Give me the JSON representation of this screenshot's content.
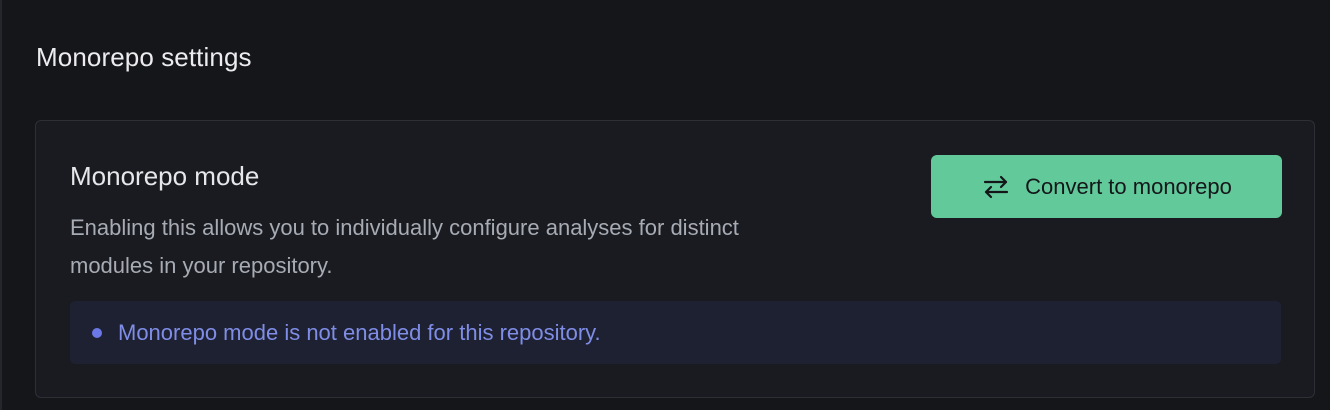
{
  "section": {
    "title": "Monorepo settings"
  },
  "card": {
    "title": "Monorepo mode",
    "description": "Enabling this allows you to individually configure analyses for distinct modules in your repository.",
    "button": {
      "label": "Convert to monorepo",
      "icon": "swap-arrows-icon",
      "color": "#62c99a"
    },
    "notice": {
      "text": "Monorepo mode is not enabled for this repository.",
      "dot_color": "#6b78e5"
    }
  }
}
